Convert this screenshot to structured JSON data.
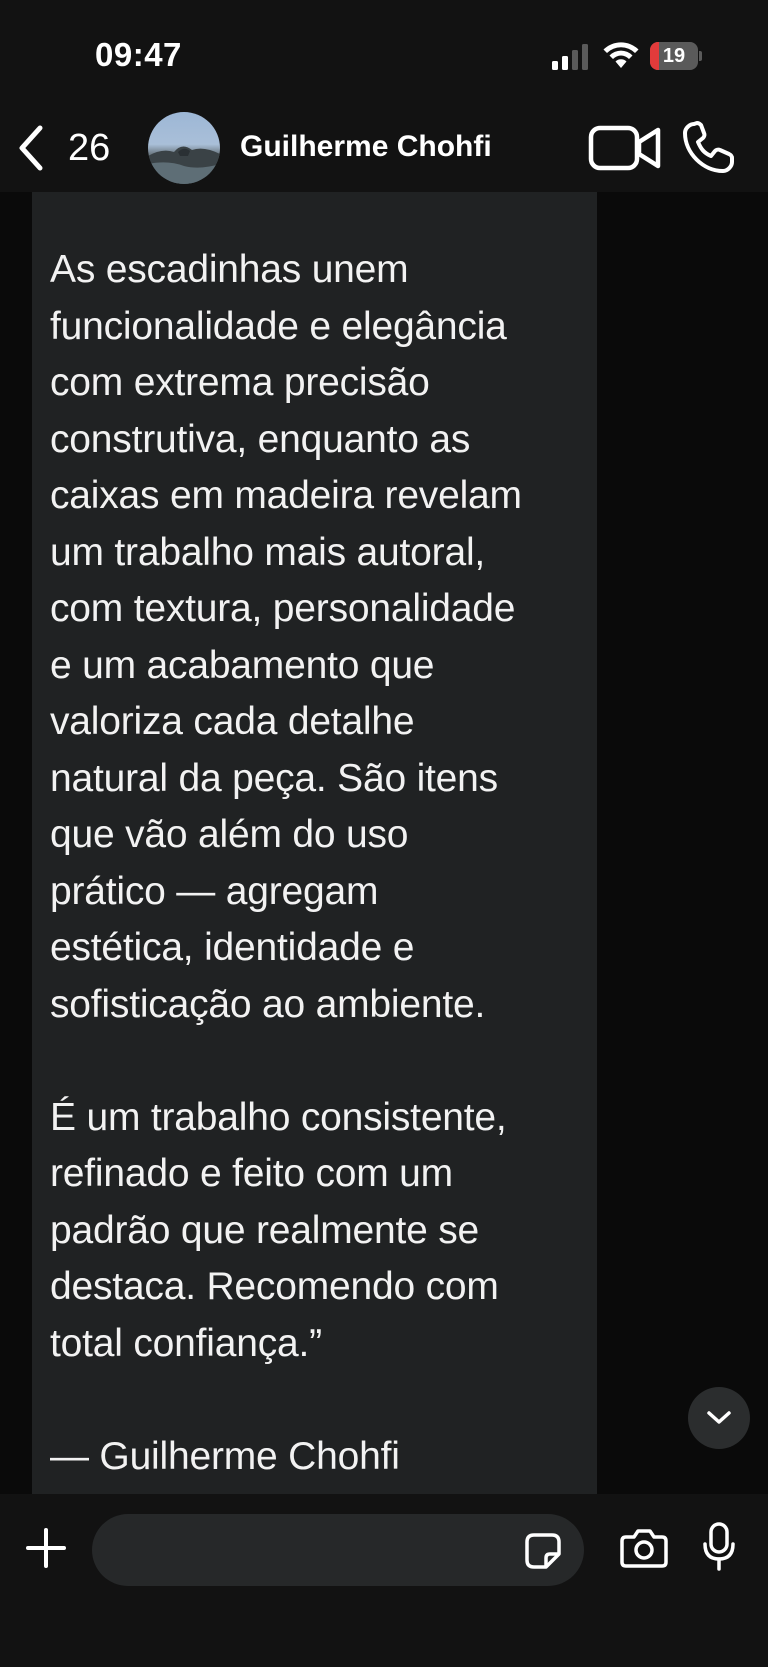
{
  "status_bar": {
    "time": "09:47",
    "battery_level": "19",
    "battery_fraction": 0.19,
    "battery_color": "#e23b3b",
    "signal_bars_active": 2,
    "icons": [
      "cellular-signal-icon",
      "wifi-icon",
      "battery-icon"
    ]
  },
  "header": {
    "back_count": "26",
    "contact_name": "Guilherme Chohfi",
    "icons": [
      "chevron-left-icon",
      "video-camera-icon",
      "phone-icon"
    ]
  },
  "message": {
    "lines_1": [
      "As escadinhas unem",
      "funcionalidade e elegância",
      "com extrema precisão",
      "construtiva, enquanto as",
      "caixas em madeira revelam",
      "um trabalho mais autoral,",
      "com textura, personalidade",
      "e um acabamento que",
      "valoriza cada detalhe",
      "natural da peça. São itens",
      "que vão além do uso",
      "prático — agregam",
      "estética, identidade e",
      "sofisticação ao ambiente."
    ],
    "lines_2": [
      "É um trabalho consistente,",
      "refinado e feito com um",
      "padrão que realmente se",
      "destaca. Recomendo com",
      "total confiança.”"
    ],
    "signature": "— Guilherme Chohfi"
  },
  "composer": {
    "input_value": "",
    "input_placeholder": "",
    "icons": [
      "plus-icon",
      "sticker-icon",
      "camera-icon",
      "microphone-icon"
    ]
  },
  "scroll_button": {
    "icon": "chevron-down-icon"
  },
  "colors": {
    "background": "#0b0b0b",
    "bar": "#121212",
    "bubble": "#202223",
    "text": "#f2f2f2"
  }
}
